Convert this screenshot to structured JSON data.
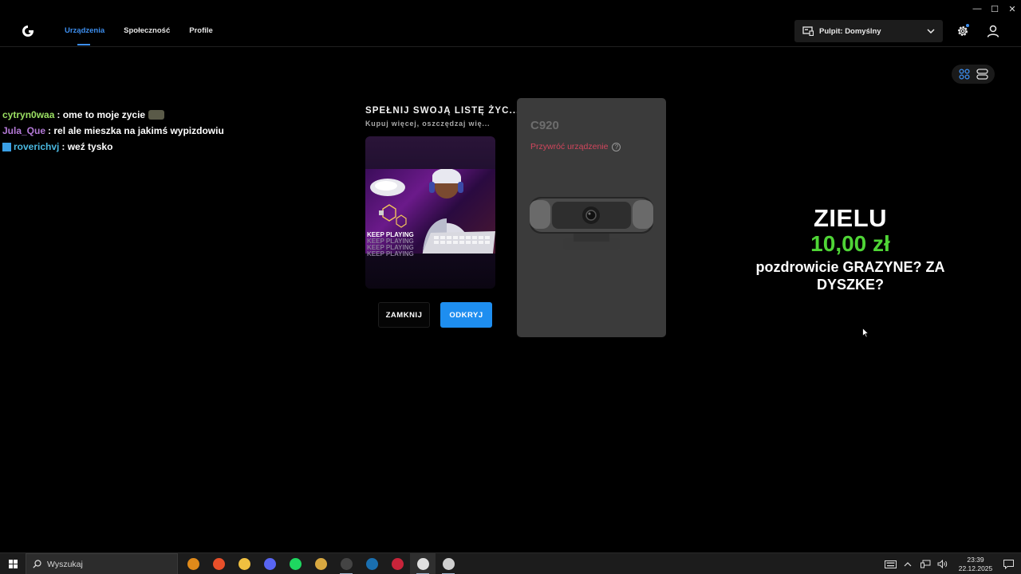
{
  "header": {
    "nav": [
      {
        "label": "Urządzenia",
        "active": true
      },
      {
        "label": "Społeczność",
        "active": false
      },
      {
        "label": "Profile",
        "active": false
      }
    ],
    "profile_select": "Pulpit: Domyślny"
  },
  "chat": [
    {
      "user": "cytryn0waa",
      "user_color": "#9be063",
      "message": ": ome to moje zycie",
      "emote": true,
      "badge": false
    },
    {
      "user": "Jula_Que",
      "user_color": "#b57ad8",
      "message": ": rel ale mieszka na jakimś wypizdowiu",
      "emote": false,
      "badge": false
    },
    {
      "user": "roverichvj",
      "user_color": "#4ab8e0",
      "message": ": weź tysko",
      "emote": false,
      "badge": true
    }
  ],
  "promo": {
    "title": "SPEŁNIJ SWOJĄ LISTĘ ŻYC...",
    "subtitle": "Kupuj więcej, oszczędzaj wię...",
    "image_text": "KEEP PLAYING",
    "close_label": "ZAMKNIJ",
    "open_label": "ODKRYJ"
  },
  "device": {
    "name": "C920",
    "restore_label": "Przywróć urządzenie"
  },
  "alert": {
    "name": "ZIELU",
    "amount": "10,00 zł",
    "message": "pozdrowicie GRAZYNE? ZA DYSZKE?"
  },
  "taskbar": {
    "search_placeholder": "Wyszukaj",
    "time": "23:39",
    "date": "22.12.2025",
    "apps": [
      {
        "name": "fl-studio-icon",
        "color": "#e08a1a",
        "open": false
      },
      {
        "name": "brave-icon",
        "color": "#e8502a",
        "open": false
      },
      {
        "name": "file-explorer-icon",
        "color": "#f0c040",
        "open": false
      },
      {
        "name": "discord-icon",
        "color": "#5865f2",
        "open": false
      },
      {
        "name": "spotify-icon",
        "color": "#1ed760",
        "open": false
      },
      {
        "name": "media-app-icon",
        "color": "#d8a840",
        "open": false
      },
      {
        "name": "obs-icon",
        "color": "#444444",
        "open": true
      },
      {
        "name": "steam-icon",
        "color": "#1a6fb0",
        "open": false
      },
      {
        "name": "video-app-icon",
        "color": "#c8243a",
        "open": false
      },
      {
        "name": "logitech-ghub-icon",
        "color": "#e0e0e0",
        "open": true
      },
      {
        "name": "mouse-app-icon",
        "color": "#cfcfcf",
        "open": true
      }
    ]
  }
}
